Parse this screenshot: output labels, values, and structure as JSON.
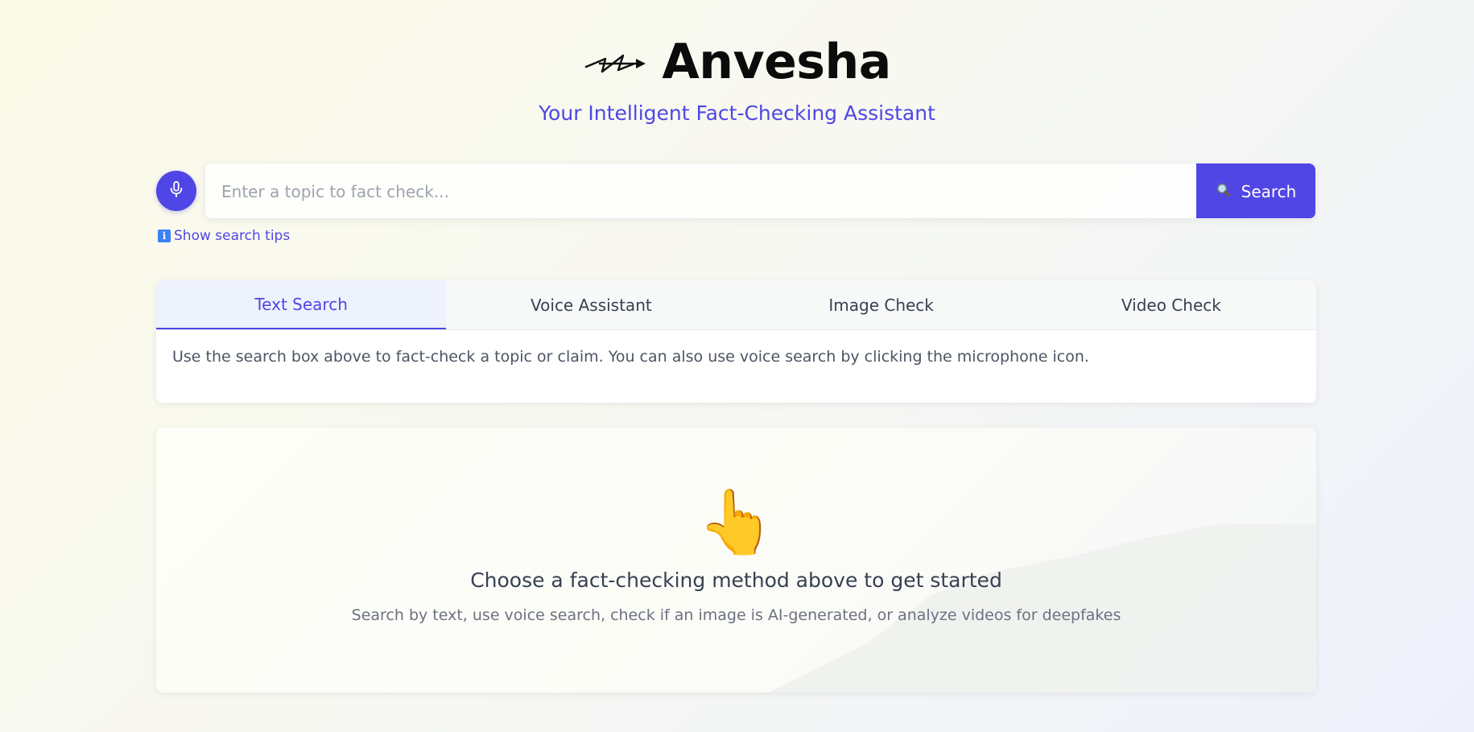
{
  "header": {
    "title": "Anvesha",
    "subtitle": "Your Intelligent Fact-Checking Assistant",
    "logo_icon": "arrow-scribble-icon"
  },
  "search": {
    "placeholder": "Enter a topic to fact check...",
    "value": "",
    "button_label": "Search",
    "button_icon": "magnifier-icon",
    "mic_icon": "microphone-icon",
    "tips_label": "Show search tips",
    "tips_icon": "info-icon"
  },
  "tabs": [
    {
      "label": "Text Search",
      "active": true
    },
    {
      "label": "Voice Assistant",
      "active": false
    },
    {
      "label": "Image Check",
      "active": false
    },
    {
      "label": "Video Check",
      "active": false
    }
  ],
  "tab_content": "Use the search box above to fact-check a topic or claim. You can also use voice search by clicking the microphone icon.",
  "empty_state": {
    "icon": "👆",
    "title": "Choose a fact-checking method above to get started",
    "description": "Search by text, use voice search, check if an image is AI-generated, or analyze videos for deepfakes"
  },
  "colors": {
    "accent": "#4f46e5",
    "title": "#0b0b0b",
    "info": "#3b82f6"
  }
}
